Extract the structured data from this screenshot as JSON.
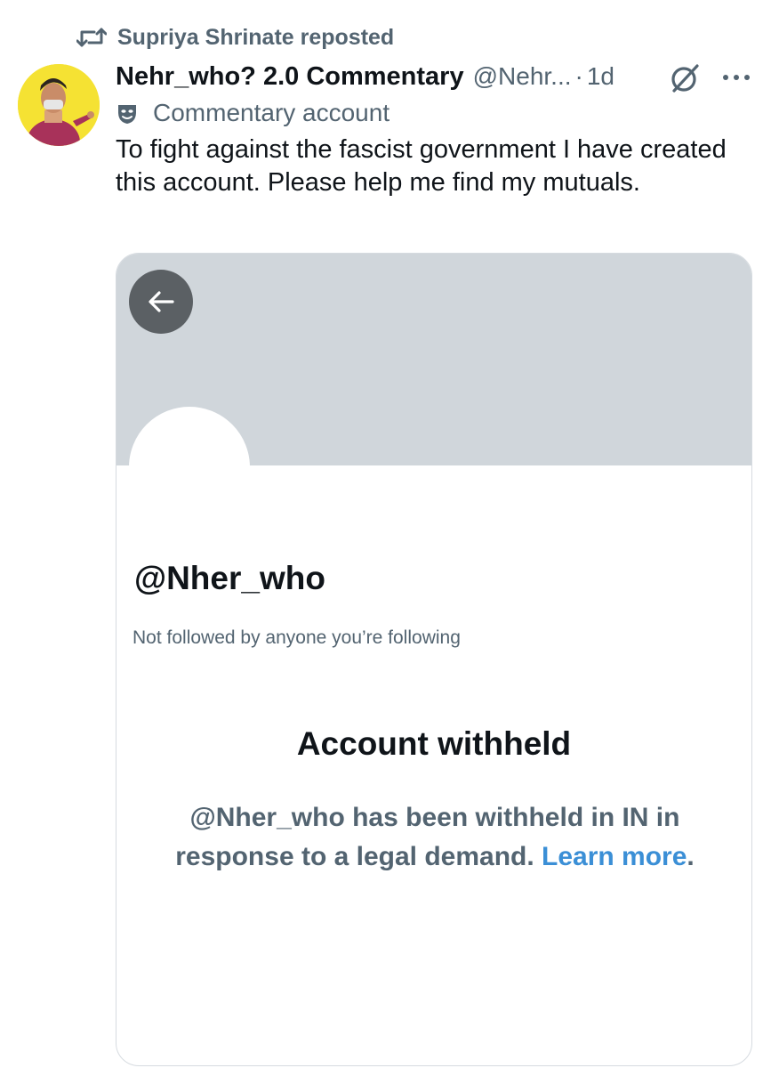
{
  "repost": {
    "text": "Supriya Shrinate reposted"
  },
  "author": {
    "display_name": "Nehr_who? 2.0 Commentary",
    "handle": "@Nehr...",
    "separator": "·",
    "time": "1d",
    "label": "Commentary account"
  },
  "tweet": {
    "text": "To fight against the fascist government I have created this account. Please help me find my mutuals."
  },
  "card": {
    "handle": "@Nher_who",
    "follow_note": "Not followed by anyone you’re following",
    "withheld_title": "Account withheld",
    "withheld_body": "@Nher_who has been withheld in IN in response to a legal demand. ",
    "learn_more": "Learn more",
    "period": "."
  },
  "colors": {
    "text_primary": "#0f1419",
    "text_secondary": "#536471",
    "banner": "#d0d6db",
    "link": "#3b8fd6",
    "avatar_bg": "#f5e233"
  },
  "icons": {
    "repost": "repost-icon",
    "grok": "grok-icon",
    "more": "more-icon",
    "label": "commentary-mask-icon",
    "back": "arrow-left-icon"
  }
}
